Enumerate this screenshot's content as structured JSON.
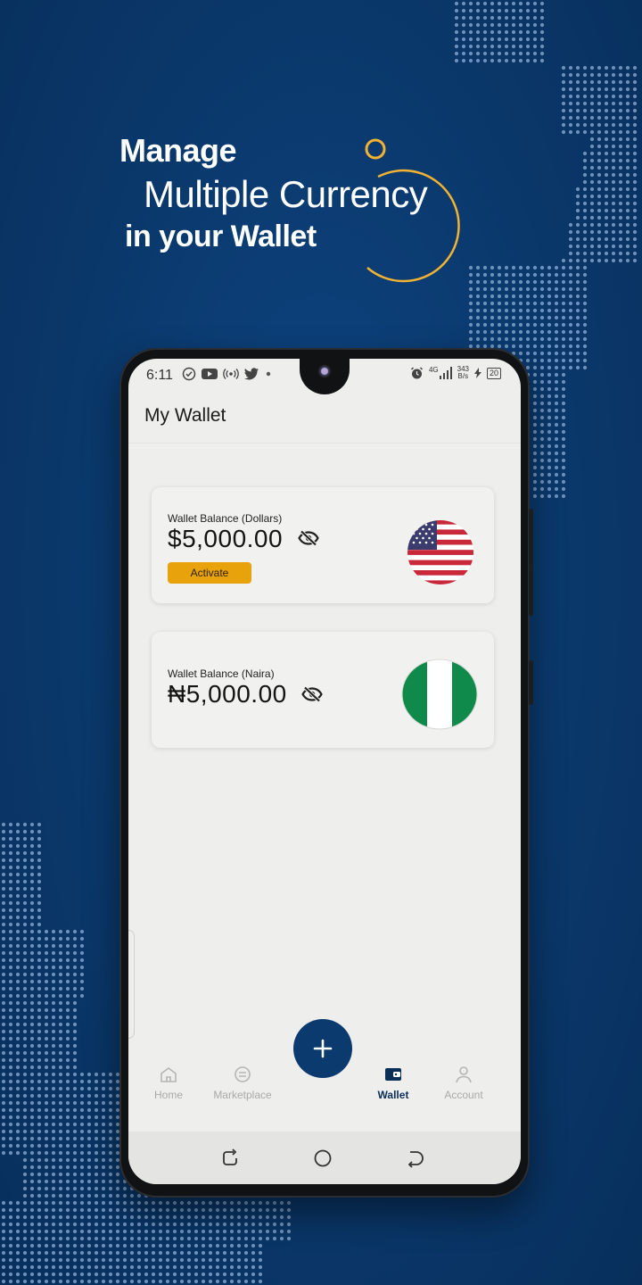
{
  "headline": {
    "line1": "Manage",
    "line2": "Multiple Currency",
    "line3": "in your Wallet"
  },
  "colors": {
    "background": "#0b3a6e",
    "accent_gold": "#e8a30c",
    "ring_gold": "#f2b233",
    "nigeria_green": "#0f8a4a"
  },
  "status_bar": {
    "time": "6:11",
    "network_type": "4G",
    "net_speed_value": "343",
    "net_speed_unit": "B/s",
    "battery": "20"
  },
  "app": {
    "title": "My Wallet"
  },
  "wallets": {
    "dollars": {
      "label": "Wallet Balance (Dollars)",
      "amount": "$5,000.00",
      "action_label": "Activate",
      "flag_icon": "us-flag-icon"
    },
    "naira": {
      "label": "Wallet Balance (Naira)",
      "amount": "₦5,000.00",
      "flag_icon": "nigeria-flag-icon"
    }
  },
  "bottom_nav": {
    "items": [
      {
        "label": "Home",
        "icon": "home-icon"
      },
      {
        "label": "Marketplace",
        "icon": "marketplace-icon"
      },
      {
        "label": "Wallet",
        "icon": "wallet-icon",
        "active": true
      },
      {
        "label": "Account",
        "icon": "account-icon"
      }
    ],
    "fab_icon": "plus-icon"
  },
  "system_nav": {
    "icons": [
      "recents-icon",
      "home-circle-icon",
      "back-icon"
    ]
  }
}
